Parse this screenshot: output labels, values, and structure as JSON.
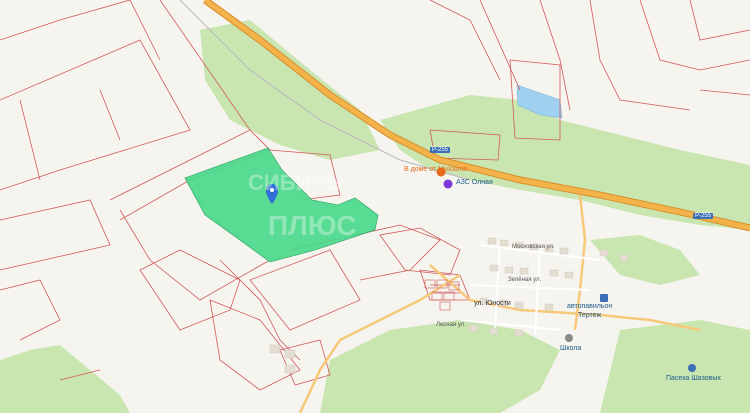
{
  "map": {
    "roads": {
      "highway_code_main": "P-255",
      "highway_code_east": "P-255",
      "highway_code_north": "P-255"
    },
    "streets": {
      "moskovskaya": "Московская ул.",
      "zelenaya": "Зелёная ул.",
      "yunosti": "ул. Юности",
      "lesnaya": "Лесная ул."
    },
    "pois": {
      "cafe": "В доме от Михаила",
      "gas_station": "АЗС Олная",
      "bus_station_line1": "автопавильон",
      "bus_station_line2": "Тертеж",
      "school": "Школа",
      "apiary": "Пасека Шазовых"
    },
    "watermark": {
      "line1": "СИБИРЬ",
      "line2": "ПЛЮС"
    },
    "colors": {
      "background": "#f6f4ef",
      "forest": "#c9e6b0",
      "selected_parcel": "#48d98a",
      "parcel_border": "#d15a5a",
      "highway": "#f4b24a",
      "road": "#f6c97a",
      "water": "#9fd0f0",
      "marker": "#2f6fd6"
    },
    "marker_icon": "map-pin-icon"
  }
}
